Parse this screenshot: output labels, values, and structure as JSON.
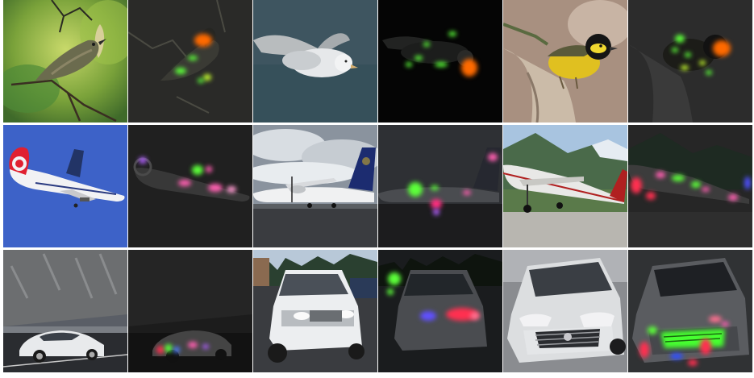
{
  "grid": {
    "rows": 3,
    "columns": 6,
    "cells": [
      {
        "row": 1,
        "col": 1,
        "subject": "bird",
        "kind": "photo"
      },
      {
        "row": 1,
        "col": 2,
        "subject": "bird",
        "kind": "saliency-overlay"
      },
      {
        "row": 1,
        "col": 3,
        "subject": "bird",
        "kind": "photo"
      },
      {
        "row": 1,
        "col": 4,
        "subject": "bird",
        "kind": "saliency-overlay"
      },
      {
        "row": 1,
        "col": 5,
        "subject": "bird",
        "kind": "photo"
      },
      {
        "row": 1,
        "col": 6,
        "subject": "bird",
        "kind": "saliency-overlay"
      },
      {
        "row": 2,
        "col": 1,
        "subject": "airplane",
        "kind": "photo"
      },
      {
        "row": 2,
        "col": 2,
        "subject": "airplane",
        "kind": "saliency-overlay"
      },
      {
        "row": 2,
        "col": 3,
        "subject": "airplane",
        "kind": "photo"
      },
      {
        "row": 2,
        "col": 4,
        "subject": "airplane",
        "kind": "saliency-overlay"
      },
      {
        "row": 2,
        "col": 5,
        "subject": "airplane",
        "kind": "photo"
      },
      {
        "row": 2,
        "col": 6,
        "subject": "airplane",
        "kind": "saliency-overlay"
      },
      {
        "row": 3,
        "col": 1,
        "subject": "car",
        "kind": "photo"
      },
      {
        "row": 3,
        "col": 2,
        "subject": "car",
        "kind": "saliency-overlay"
      },
      {
        "row": 3,
        "col": 3,
        "subject": "car",
        "kind": "photo"
      },
      {
        "row": 3,
        "col": 4,
        "subject": "car",
        "kind": "saliency-overlay"
      },
      {
        "row": 3,
        "col": 5,
        "subject": "car",
        "kind": "photo"
      },
      {
        "row": 3,
        "col": 6,
        "subject": "car",
        "kind": "saliency-overlay"
      }
    ]
  },
  "colors": {
    "background": "#ffffff",
    "overlay_dark": "#1e1e1e",
    "highlight_orange": "#ff6a00",
    "highlight_green": "#5cff3a",
    "highlight_pink": "#ff5fb0",
    "highlight_red": "#ff3050",
    "highlight_purple": "#b060ff"
  }
}
